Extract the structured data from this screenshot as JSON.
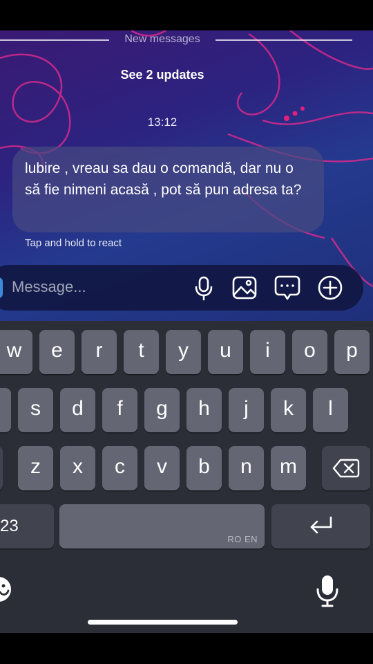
{
  "thread": {
    "divider_label": "New messages",
    "updates_link": "See 2 updates",
    "timestamp": "13:12",
    "message_text": "lubire , vreau sa dau o comandă, dar nu o să fie nimeni acasă , pot să pun adresa ta?",
    "react_hint": "Tap and hold to react"
  },
  "composer": {
    "placeholder": "Message...",
    "buttons": [
      "microphone-icon",
      "image-icon",
      "sticker-chat-icon",
      "plus-icon"
    ]
  },
  "keyboard": {
    "row1": [
      "w",
      "e",
      "r",
      "t",
      "y",
      "u",
      "i",
      "o",
      "p"
    ],
    "row2": [
      "s",
      "d",
      "f",
      "g",
      "h",
      "j",
      "k",
      "l"
    ],
    "row3": [
      "z",
      "x",
      "c",
      "v",
      "b",
      "n",
      "m"
    ],
    "numbers_key": "23",
    "space_language": "RO EN",
    "bottom_icons": [
      "emoji-icon",
      "dictation-mic-icon"
    ]
  },
  "colors": {
    "accent_pink": "#e2207f",
    "key": "#646674",
    "key_dark": "#41434f",
    "keyboard_bg": "#2c2e37",
    "composer_bg": "#101640"
  }
}
